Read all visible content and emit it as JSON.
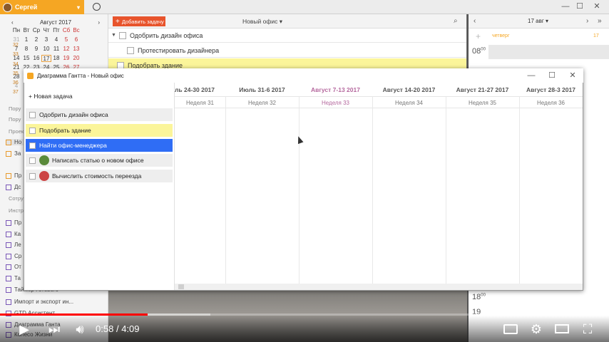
{
  "topbar": {
    "user_name": "Сергей"
  },
  "calendar": {
    "month_label": "Август 2017",
    "weekdays": [
      "Пн",
      "Вт",
      "Ср",
      "Чт",
      "Пт",
      "Сб",
      "Вс"
    ],
    "weeks": [
      [
        "31",
        "1",
        "2",
        "3",
        "4",
        "5",
        "6"
      ],
      [
        "7",
        "8",
        "9",
        "10",
        "11",
        "12",
        "13"
      ],
      [
        "14",
        "15",
        "16",
        "17",
        "18",
        "19",
        "20"
      ],
      [
        "21",
        "22",
        "23",
        "24",
        "25",
        "26",
        "27"
      ],
      [
        "28",
        "29",
        "30",
        "31",
        "1",
        "2",
        "3"
      ],
      [
        "4",
        "5",
        "6",
        "7",
        "8",
        "9",
        "10"
      ]
    ],
    "week_numbers": [
      "32",
      "33",
      "34",
      "35",
      "36",
      "37"
    ]
  },
  "sidebar": {
    "items": [
      {
        "label": "Пору"
      },
      {
        "label": "Пору"
      },
      {
        "label": "Проек"
      },
      {
        "label": "Но"
      },
      {
        "label": "За"
      },
      {
        "label": "Пр"
      },
      {
        "label": "Дс"
      },
      {
        "label": "Сотру"
      },
      {
        "label": "Инстр"
      },
      {
        "label": "Пр"
      },
      {
        "label": "Ка"
      },
      {
        "label": "Ле"
      },
      {
        "label": "Ср"
      },
      {
        "label": "От"
      },
      {
        "label": "Та"
      },
      {
        "label": "Таймер Готового"
      },
      {
        "label": "Импорт и экспорт ин..."
      },
      {
        "label": "GTD Ассистент"
      },
      {
        "label": "Диаграмма Ганта"
      },
      {
        "label": "Колесо Жизни"
      }
    ]
  },
  "main": {
    "add_task_label": "Добавить задачу",
    "project_title": "Новый офис",
    "tasks": [
      {
        "label": "Одобрить дизайн офиса"
      },
      {
        "label": "Протестировать дизайнера"
      },
      {
        "label": "Подобрать здание"
      }
    ]
  },
  "right_panel": {
    "date_label": "17 авг",
    "day_label": "четверг",
    "day_number": "17",
    "hour_top": "08",
    "hour_top_min": "00",
    "hour_bottom": "18",
    "hour_bottom_min": "00",
    "hour_last": "19"
  },
  "gantt": {
    "title": "Диаграмма Гантта - Новый офис",
    "new_task_label": "+ Новая задача",
    "tasks": [
      {
        "label": "Одобрить дизайн офиса"
      },
      {
        "label": "Подобрать здание"
      },
      {
        "label": "Найти офис-менеджера"
      },
      {
        "label": "Написать статью о новом офисе"
      },
      {
        "label": "Вычислить стоимость переезда"
      }
    ],
    "periods": [
      {
        "label": "ль 24-30 2017",
        "week": "Неделя 31"
      },
      {
        "label": "Июль 31-6 2017",
        "week": "Неделя 32"
      },
      {
        "label": "Август 7-13 2017",
        "week": "Неделя 33"
      },
      {
        "label": "Август 14-20 2017",
        "week": "Неделя 34"
      },
      {
        "label": "Август 21-27 2017",
        "week": "Неделя 35"
      },
      {
        "label": "Август 28-3 2017",
        "week": "Неделя 36"
      }
    ],
    "current_period_color": "#b5689e",
    "highlight_color": "#fbf59a",
    "selected_color": "#2f6df5"
  },
  "video": {
    "time_current": "0:58",
    "time_separator": "/",
    "time_total": "4:09",
    "progress_fraction": 0.242,
    "progress_color": "#ff0000"
  }
}
